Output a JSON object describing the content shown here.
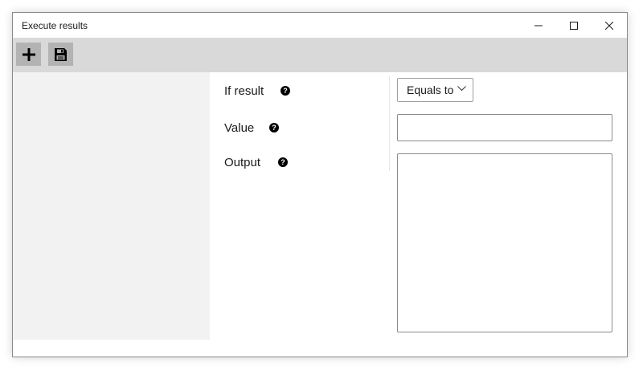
{
  "window": {
    "title": "Execute results"
  },
  "toolbar": {
    "add_icon": "plus-icon",
    "save_icon": "floppy-disk-icon"
  },
  "form": {
    "if_result": {
      "label": "If result",
      "help": "?",
      "selected": "Equals to"
    },
    "value": {
      "label": "Value",
      "help": "?",
      "current": ""
    },
    "output": {
      "label": "Output",
      "help": "?",
      "current": ""
    }
  },
  "colors": {
    "toolbar_bg": "#d9d9d9",
    "toolbar_button_bg": "#b3b3b3",
    "left_panel_bg": "#f2f2f2",
    "input_border": "#8a8a8a"
  }
}
